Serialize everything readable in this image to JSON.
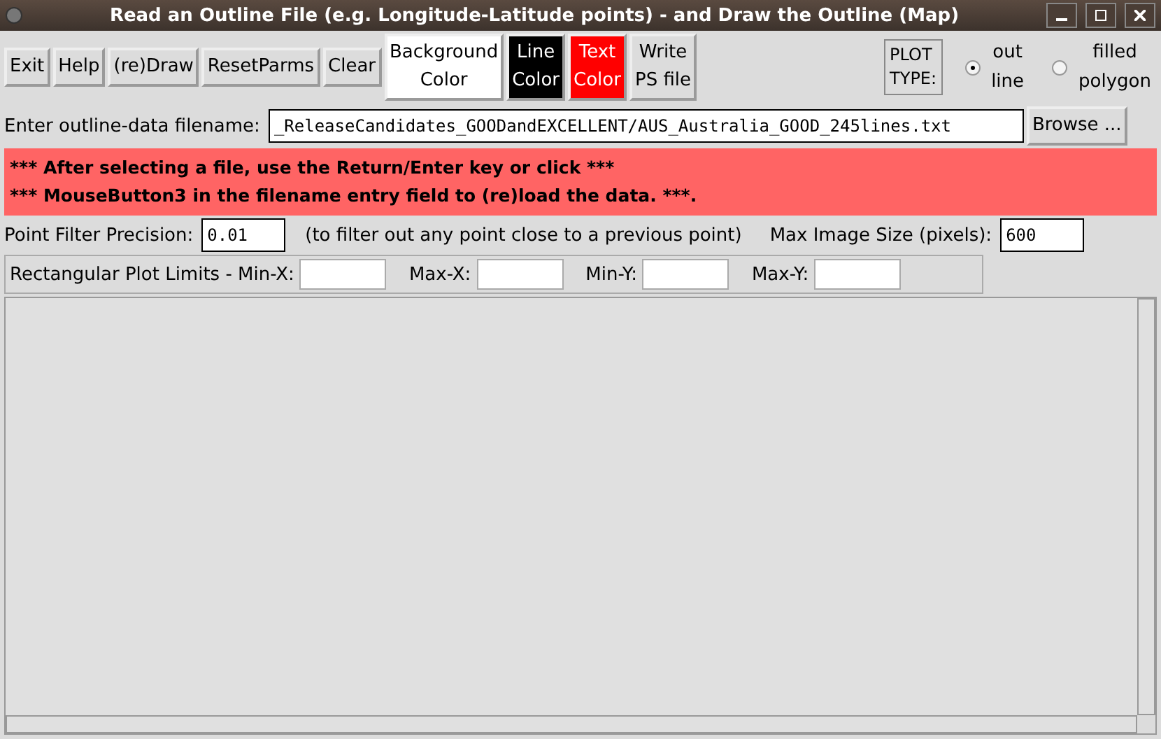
{
  "window": {
    "title": "Read an Outline File (e.g. Longitude-Latitude points) - and Draw the Outline (Map)"
  },
  "toolbar": {
    "buttons": [
      {
        "label": "Exit",
        "kind": "plain"
      },
      {
        "label": "Help",
        "kind": "plain"
      },
      {
        "label": "(re)Draw",
        "kind": "plain"
      },
      {
        "label": "ResetParms",
        "kind": "plain"
      },
      {
        "label": "Clear",
        "kind": "plain"
      },
      {
        "label": "Background\nColor",
        "kind": "color",
        "color": "#ffffff"
      },
      {
        "label": "Line\nColor",
        "kind": "color",
        "color": "#000000"
      },
      {
        "label": "Text\nColor",
        "kind": "color",
        "color": "#ff0000"
      },
      {
        "label": "Write\nPS file",
        "kind": "plain"
      }
    ],
    "plot_type": {
      "label": "PLOT\nTYPE:",
      "options": [
        {
          "label": "out\nline",
          "selected": true
        },
        {
          "label": "filled\npolygon",
          "selected": false
        }
      ]
    }
  },
  "file": {
    "label": "Enter outline-data filename:",
    "value": "_ReleaseCandidates_GOODandEXCELLENT/AUS_Australia_GOOD_245lines.txt",
    "browse": "Browse ..."
  },
  "message": [
    "*** After selecting a file, use the Return/Enter key or click ***",
    "*** MouseButton3 in the filename entry field to (re)load the data. ***."
  ],
  "filter": {
    "label": "Point Filter Precision:",
    "value": "0.01",
    "note": "(to filter out any point close to a previous point)",
    "size_label": "Max Image Size (pixels):",
    "size_value": "600"
  },
  "limits": {
    "label": "Rectangular Plot Limits - Min-X:",
    "fields": [
      {
        "label": "Max-X:"
      },
      {
        "label": "Min-Y:"
      },
      {
        "label": "Max-Y:"
      }
    ]
  }
}
